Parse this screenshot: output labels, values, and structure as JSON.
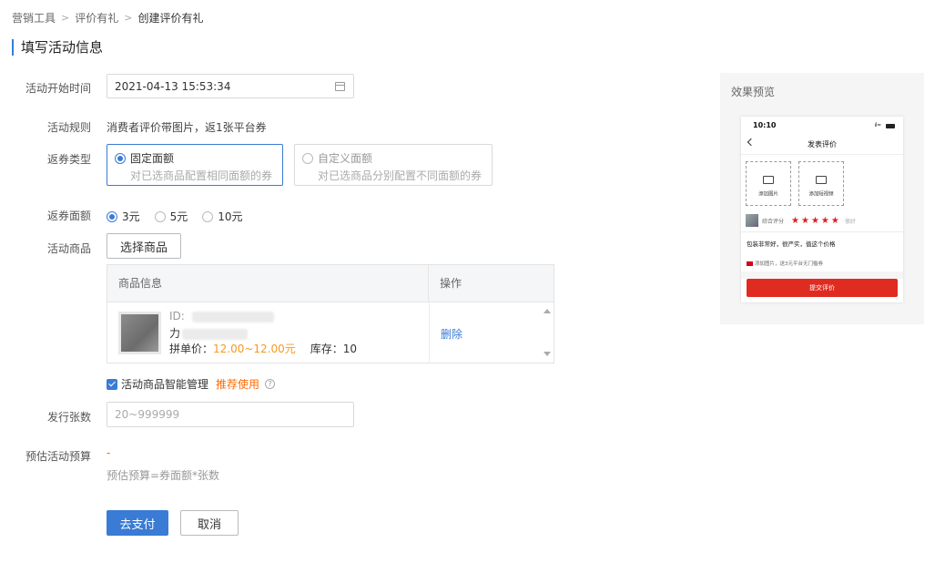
{
  "breadcrumb": {
    "items": [
      "营销工具",
      "评价有礼",
      "创建评价有礼"
    ]
  },
  "section_title": "填写活动信息",
  "form": {
    "start_time": {
      "label": "活动开始时间",
      "value": "2021-04-13 15:53:34"
    },
    "rule": {
      "label": "活动规则",
      "value": "消费者评价带图片，返1张平台券"
    },
    "coupon_type": {
      "label": "返券类型",
      "options": [
        {
          "title": "固定面额",
          "desc": "对已选商品配置相同面额的券",
          "selected": true
        },
        {
          "title": "自定义面额",
          "desc": "对已选商品分别配置不同面额的券",
          "selected": false
        }
      ]
    },
    "coupon_value": {
      "label": "返券面额",
      "options": [
        {
          "text": "3元",
          "selected": true
        },
        {
          "text": "5元",
          "selected": false
        },
        {
          "text": "10元",
          "selected": false
        }
      ]
    },
    "products": {
      "label": "活动商品",
      "select_button": "选择商品",
      "table": {
        "headers": [
          "商品信息",
          "操作"
        ],
        "rows": [
          {
            "id_label": "ID:",
            "name_prefix": "力",
            "price_label": "拼单价：",
            "price": "12.00~12.00元",
            "stock": "库存：10",
            "action": "删除"
          }
        ]
      },
      "smart_manage": {
        "label": "活动商品智能管理",
        "recommend": "推荐使用",
        "checked": true,
        "help_icon": "question-circle-icon"
      }
    },
    "quantity": {
      "label": "发行张数",
      "placeholder": "20~999999"
    },
    "budget": {
      "label": "预估活动预算",
      "value": "-",
      "hint": "预估预算=券面额*张数"
    }
  },
  "actions": {
    "pay": "去支付",
    "cancel": "取消"
  },
  "preview": {
    "title": "效果预览",
    "phone": {
      "time": "10:10",
      "signal": "ıl ≈",
      "nav_title": "发表评价",
      "add_photo": "添加图片",
      "add_video": "添加短视频",
      "rating_label": "综合评分",
      "stars": "★★★★★",
      "rating_text": "很好",
      "review_text": "包装非常好，很严实，值这个价格",
      "note": "添加图片，送3元平台无门槛券",
      "submit": "提交评价"
    }
  },
  "colors": {
    "primary": "#3a7bd5",
    "price": "#f59a23",
    "recommend": "#ff6a00",
    "submit": "#e02b20"
  }
}
